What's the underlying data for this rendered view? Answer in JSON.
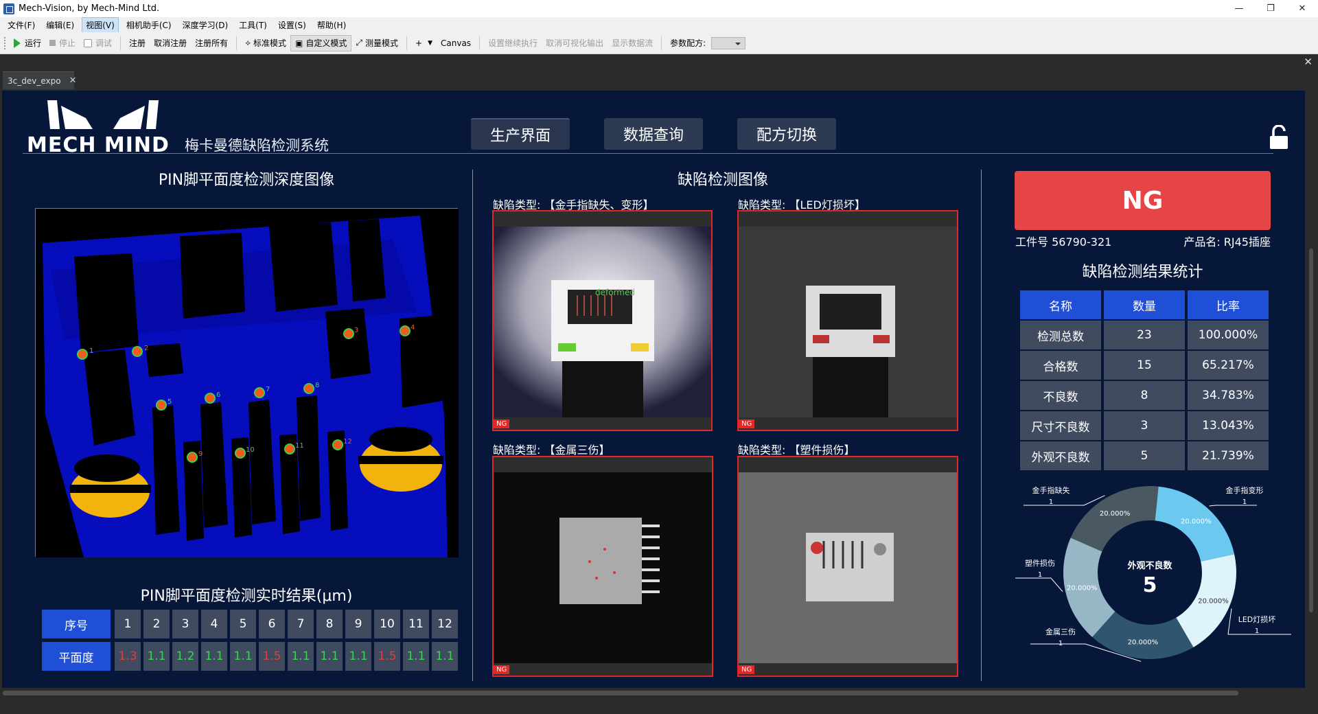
{
  "window": {
    "title": "Mech-Vision, by Mech-Mind Ltd.",
    "minimize": "—",
    "restore": "❐",
    "close": "✕"
  },
  "menu": [
    "文件(F)",
    "编辑(E)",
    "视图(V)",
    "相机助手(C)",
    "深度学习(D)",
    "工具(T)",
    "设置(S)",
    "帮助(H)"
  ],
  "toolbar": {
    "run": "运行",
    "stop": "停止",
    "debug": "调试",
    "register": "注册",
    "unregister": "取消注册",
    "register_all": "注册所有",
    "std_mode": "标准模式",
    "custom_mode": "自定义模式",
    "measure_mode": "测量模式",
    "add": "+",
    "canvas": "Canvas",
    "set_continue": "设置继续执行",
    "cancel_vis": "取消可视化输出",
    "show_flow": "显示数据流",
    "param_recipe": "参数配方:"
  },
  "tab": {
    "name": "3c_dev_expo",
    "close": "✕"
  },
  "close_strip": "✕",
  "header": {
    "logo": "MECH MIND",
    "system_title": "梅卡曼德缺陷检测系统",
    "nav": [
      "生产界面",
      "数据查询",
      "配方切换"
    ]
  },
  "left": {
    "depth_title": "PIN脚平面度检测深度图像",
    "result_title": "PIN脚平面度检测实时结果(μm)",
    "row_index_label": "序号",
    "row_value_label": "平面度",
    "pins": [
      {
        "n": "1",
        "v": "1.3",
        "ok": false
      },
      {
        "n": "2",
        "v": "1.1",
        "ok": true
      },
      {
        "n": "3",
        "v": "1.2",
        "ok": true
      },
      {
        "n": "4",
        "v": "1.1",
        "ok": true
      },
      {
        "n": "5",
        "v": "1.1",
        "ok": true
      },
      {
        "n": "6",
        "v": "1.5",
        "ok": false
      },
      {
        "n": "7",
        "v": "1.1",
        "ok": true
      },
      {
        "n": "8",
        "v": "1.1",
        "ok": true
      },
      {
        "n": "9",
        "v": "1.1",
        "ok": true
      },
      {
        "n": "10",
        "v": "1.5",
        "ok": false
      },
      {
        "n": "11",
        "v": "1.1",
        "ok": true
      },
      {
        "n": "12",
        "v": "1.1",
        "ok": true
      }
    ],
    "pin_markers": [
      "1",
      "2",
      "3",
      "4",
      "5",
      "6",
      "7",
      "8",
      "9",
      "10",
      "11",
      "12"
    ]
  },
  "center": {
    "title": "缺陷检测图像",
    "defects": [
      {
        "label": "缺陷类型: 【金手指缺失、变形】",
        "tag": "NG",
        "overlay": "deformed"
      },
      {
        "label": "缺陷类型: 【LED灯损坏】",
        "tag": "NG"
      },
      {
        "label": "缺陷类型: 【金属三伤】",
        "tag": "NG"
      },
      {
        "label": "缺陷类型: 【塑件损伤】",
        "tag": "NG"
      }
    ]
  },
  "right": {
    "result": "NG",
    "work_no": "工件号 56790-321",
    "product": "产品名: RJ45插座",
    "stats_title": "缺陷检测结果统计",
    "stats_header": [
      "名称",
      "数量",
      "比率"
    ],
    "stats_rows": [
      [
        "检测总数",
        "23",
        "100.000%"
      ],
      [
        "合格数",
        "15",
        "65.217%"
      ],
      [
        "不良数",
        "8",
        "34.783%"
      ],
      [
        "尺寸不良数",
        "3",
        "13.043%"
      ],
      [
        "外观不良数",
        "5",
        "21.739%"
      ]
    ]
  },
  "chart_data": {
    "type": "pie",
    "title": "",
    "center_label": "外观不良数",
    "center_value": "5",
    "slices": [
      {
        "name": "金手指变形",
        "count": "1",
        "percent": 20.0,
        "label": "20.000%",
        "color": "#6cc8ee"
      },
      {
        "name": "LED灯损坏",
        "count": "1",
        "percent": 20.0,
        "label": "20.000%",
        "color": "#dff3fb"
      },
      {
        "name": "金属三伤",
        "count": "1",
        "percent": 20.0,
        "label": "20.000%",
        "color": "#2f566e"
      },
      {
        "name": "塑件损伤",
        "count": "1",
        "percent": 20.0,
        "label": "20.000%",
        "color": "#98b7c6"
      },
      {
        "name": "金手指缺失",
        "count": "1",
        "percent": 20.0,
        "label": "20.000%",
        "color": "#4a5961"
      }
    ]
  },
  "colors": {
    "panel_bg": "#06173a",
    "accent_blue": "#1f4fd6",
    "ng_red": "#e64545",
    "ok_green": "#34d64a"
  }
}
